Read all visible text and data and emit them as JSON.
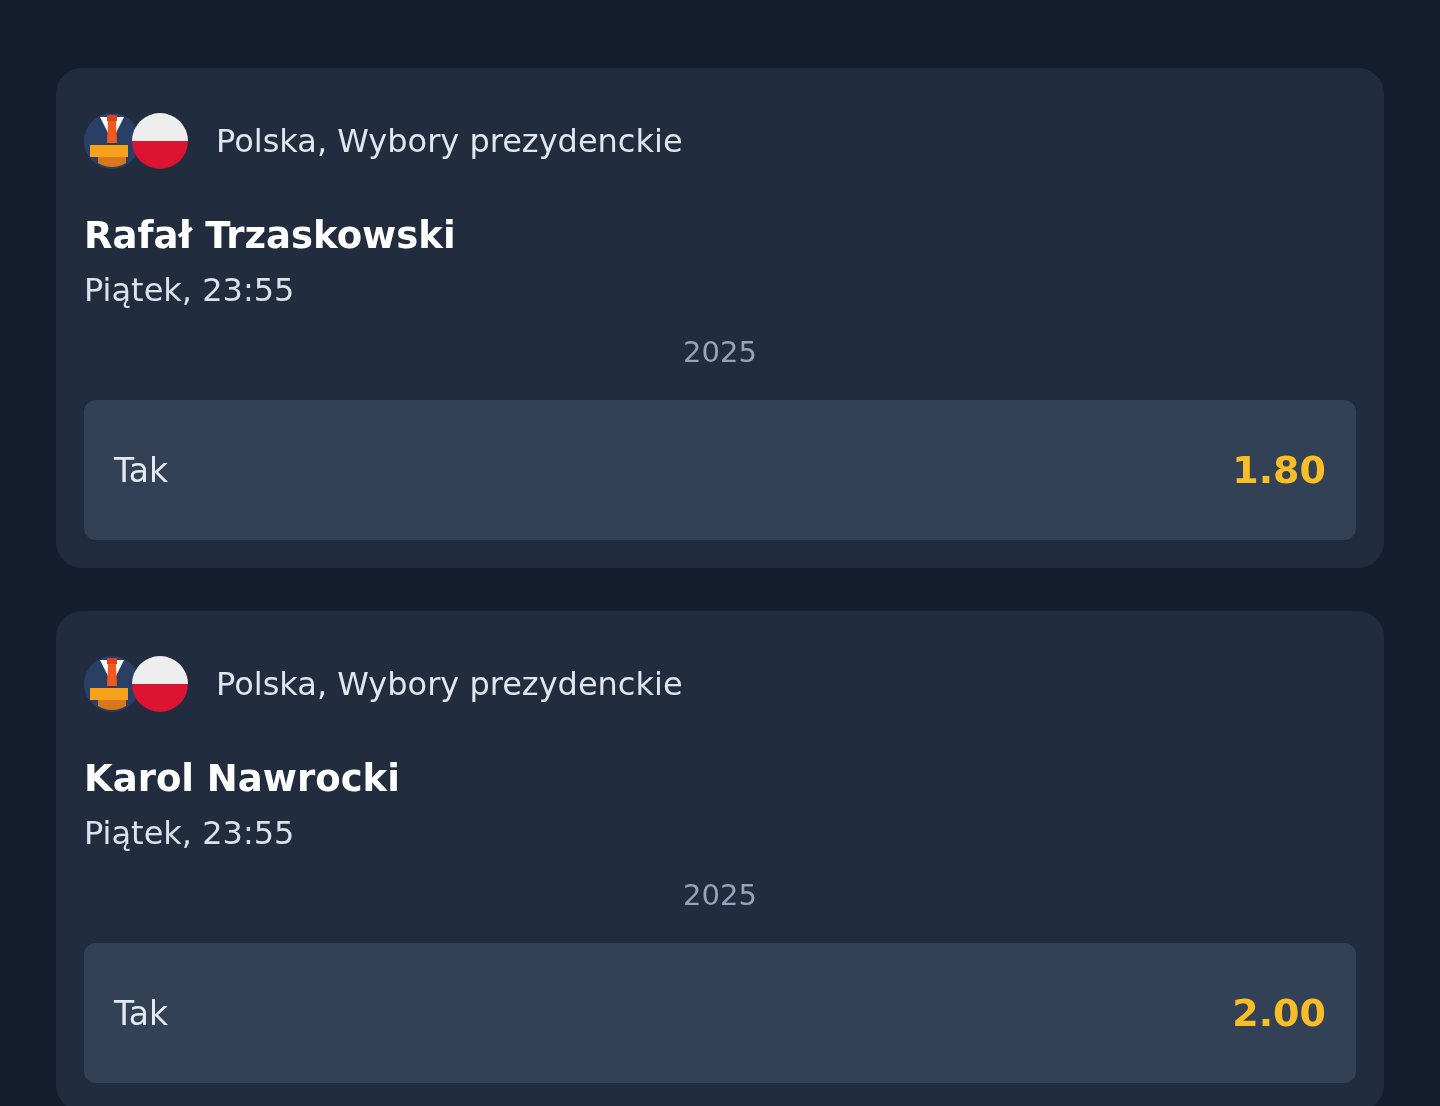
{
  "events": [
    {
      "category": "Polska, Wybory prezydenckie",
      "name": "Rafał Trzaskowski",
      "time": "Piątek, 23:55",
      "year": "2025",
      "selection": {
        "label": "Tak",
        "odds": "1.80"
      }
    },
    {
      "category": "Polska, Wybory prezydenckie",
      "name": "Karol Nawrocki",
      "time": "Piątek, 23:55",
      "year": "2025",
      "selection": {
        "label": "Tak",
        "odds": "2.00"
      }
    }
  ]
}
